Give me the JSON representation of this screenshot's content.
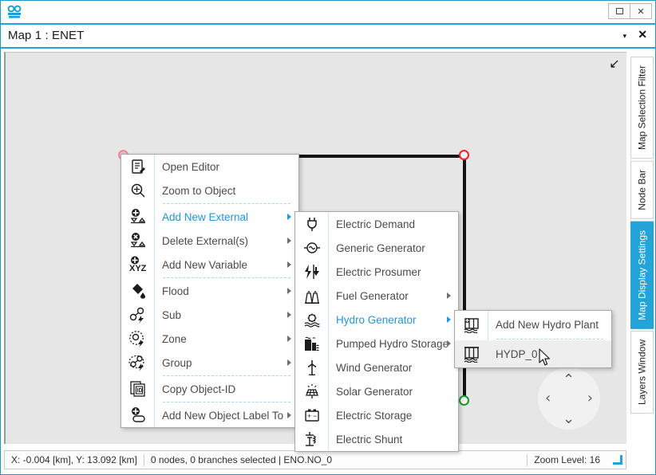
{
  "window": {
    "app_icon": "enet-logo-icon",
    "restore_label": "□",
    "close_label": "✕"
  },
  "document_tab": {
    "title": "Map 1 : ENET",
    "chevron": "▾",
    "close": "✕"
  },
  "canvas": {
    "collapse_icon": "↙",
    "zoom_in_label": "+",
    "nav": {
      "up": "⌃",
      "down": "⌄",
      "left": "‹",
      "right": "›"
    }
  },
  "status_bar": {
    "coordinates": "X: -0.004 [km], Y: 13.092 [km]",
    "selection": "0 nodes, 0 branches selected  |  ENO.NO_0",
    "zoom_level": "Zoom Level: 16"
  },
  "right_tabs": [
    {
      "label": "Map Selection Filter",
      "active": false
    },
    {
      "label": "Node Bar",
      "active": false
    },
    {
      "label": "Map Display Settings",
      "active": true
    },
    {
      "label": "Layers Window",
      "active": false
    }
  ],
  "context_menu": {
    "items": [
      {
        "label": "Open Editor",
        "icon": "editor-icon",
        "submenu": false,
        "highlight": false,
        "sep_after": false
      },
      {
        "label": "Zoom to Object",
        "icon": "zoom-object-icon",
        "submenu": false,
        "highlight": false,
        "sep_after": true
      },
      {
        "label": "Add New External",
        "icon": "add-external-icon",
        "submenu": true,
        "highlight": true,
        "sep_after": false
      },
      {
        "label": "Delete External(s)",
        "icon": "delete-external-icon",
        "submenu": true,
        "highlight": false,
        "sep_after": false
      },
      {
        "label": "Add New Variable",
        "icon": "add-xyz-icon",
        "submenu": true,
        "highlight": false,
        "sep_after": true
      },
      {
        "label": "Flood",
        "icon": "flood-icon",
        "submenu": true,
        "highlight": false,
        "sep_after": false
      },
      {
        "label": "Sub",
        "icon": "sub-icon",
        "submenu": true,
        "highlight": false,
        "sep_after": false
      },
      {
        "label": "Zone",
        "icon": "zone-icon",
        "submenu": true,
        "highlight": false,
        "sep_after": false
      },
      {
        "label": "Group",
        "icon": "group-icon",
        "submenu": true,
        "highlight": false,
        "sep_after": true
      },
      {
        "label": "Copy Object-ID",
        "icon": "copy-id-icon",
        "submenu": false,
        "highlight": false,
        "sep_after": true
      },
      {
        "label": "Add New Object Label To",
        "icon": "add-label-icon",
        "submenu": true,
        "highlight": false,
        "sep_after": false
      }
    ]
  },
  "submenu_external": {
    "items": [
      {
        "label": "Electric Demand",
        "icon": "plug-icon",
        "submenu": false,
        "highlight": false
      },
      {
        "label": "Generic Generator",
        "icon": "generic-gen-icon",
        "submenu": false,
        "highlight": false
      },
      {
        "label": "Electric Prosumer",
        "icon": "prosumer-icon",
        "submenu": false,
        "highlight": false
      },
      {
        "label": "Fuel Generator",
        "icon": "fuel-gen-icon",
        "submenu": true,
        "highlight": false
      },
      {
        "label": "Hydro Generator",
        "icon": "hydro-gen-icon",
        "submenu": true,
        "highlight": true
      },
      {
        "label": "Pumped Hydro Storage",
        "icon": "pumped-hydro-icon",
        "submenu": true,
        "highlight": false
      },
      {
        "label": "Wind Generator",
        "icon": "wind-gen-icon",
        "submenu": false,
        "highlight": false
      },
      {
        "label": "Solar Generator",
        "icon": "solar-gen-icon",
        "submenu": false,
        "highlight": false
      },
      {
        "label": "Electric Storage",
        "icon": "battery-icon",
        "submenu": false,
        "highlight": false
      },
      {
        "label": "Electric Shunt",
        "icon": "shunt-icon",
        "submenu": false,
        "highlight": false
      }
    ]
  },
  "submenu_hydro": {
    "items": [
      {
        "label": "Add New Hydro Plant",
        "icon": "add-hydro-plant-icon",
        "hover": false
      },
      {
        "label": "HYDP_0",
        "icon": "hydro-plant-icon",
        "hover": true
      }
    ]
  }
}
